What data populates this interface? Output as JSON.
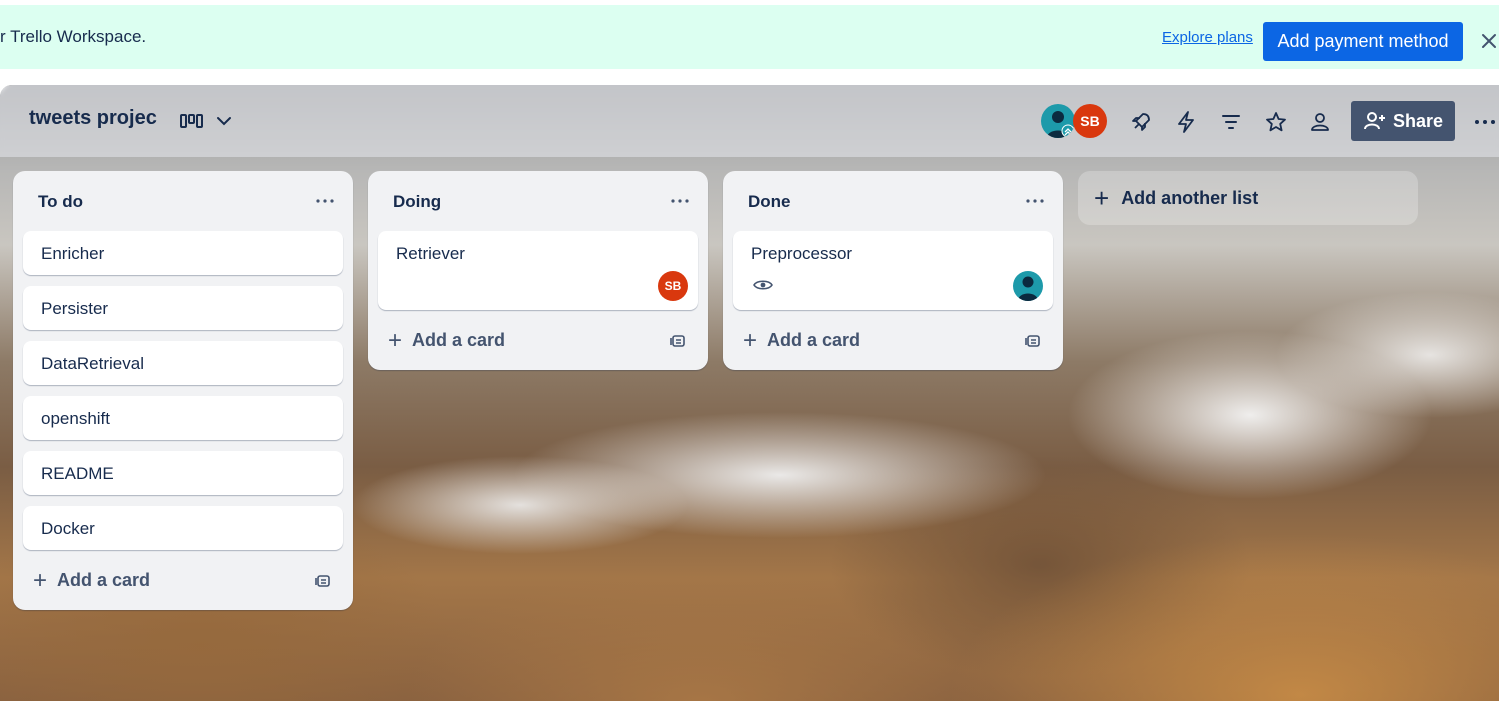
{
  "banner": {
    "text": "r Trello Workspace.",
    "explore_label": "Explore plans",
    "add_payment_label": "Add payment method"
  },
  "board": {
    "title": "tweets projec",
    "share_label": "Share",
    "members": [
      {
        "initials": ""
      },
      {
        "initials": "SB"
      }
    ],
    "add_list_label": "Add another list"
  },
  "lists": [
    {
      "title": "To do",
      "cards": [
        {
          "title": "Enricher"
        },
        {
          "title": "Persister"
        },
        {
          "title": "DataRetrieval"
        },
        {
          "title": "openshift"
        },
        {
          "title": "README"
        },
        {
          "title": "Docker"
        }
      ],
      "add_card_label": "Add a card"
    },
    {
      "title": "Doing",
      "cards": [
        {
          "title": "Retriever",
          "member_initials": "SB"
        }
      ],
      "add_card_label": "Add a card"
    },
    {
      "title": "Done",
      "cards": [
        {
          "title": "Preprocessor",
          "watch_icon": "eye-icon"
        }
      ],
      "add_card_label": "Add a card"
    }
  ],
  "colors": {
    "banner_bg": "#dcfff1",
    "primary": "#0c66e4",
    "list_bg": "#f1f2f4",
    "avatar_sb": "#d9380e",
    "avatar_person": "#1d9aaa",
    "share_bg": "#44546f"
  }
}
